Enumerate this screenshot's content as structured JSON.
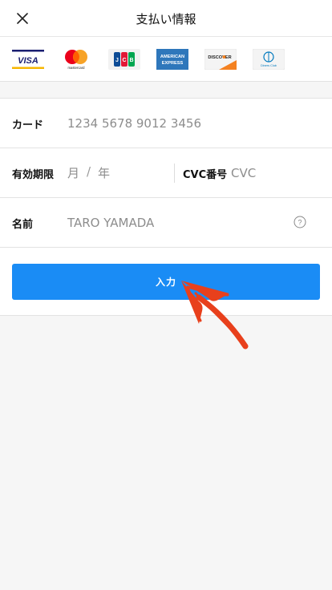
{
  "header": {
    "title": "支払い情報",
    "close_icon": "close-icon"
  },
  "brands": [
    {
      "name": "VISA",
      "icon": "visa-logo"
    },
    {
      "name": "mastercard",
      "icon": "mastercard-logo"
    },
    {
      "name": "JCB",
      "icon": "jcb-logo"
    },
    {
      "name": "AMERICAN EXPRESS",
      "icon": "amex-logo"
    },
    {
      "name": "DISCOVER",
      "icon": "discover-logo"
    },
    {
      "name": "Diners Club",
      "icon": "diners-logo"
    }
  ],
  "form": {
    "card_label": "カード",
    "card_placeholder": "1234 5678 9012 3456",
    "expiry_label": "有効期限",
    "month_placeholder": "月",
    "separator": "/",
    "year_placeholder": "年",
    "cvc_label": "CVC番号",
    "cvc_placeholder": "CVC",
    "name_label": "名前",
    "name_placeholder": "TARO YAMADA",
    "submit_label": "入力"
  },
  "colors": {
    "primary": "#1a8cf5",
    "annotation": "#e8401c"
  }
}
